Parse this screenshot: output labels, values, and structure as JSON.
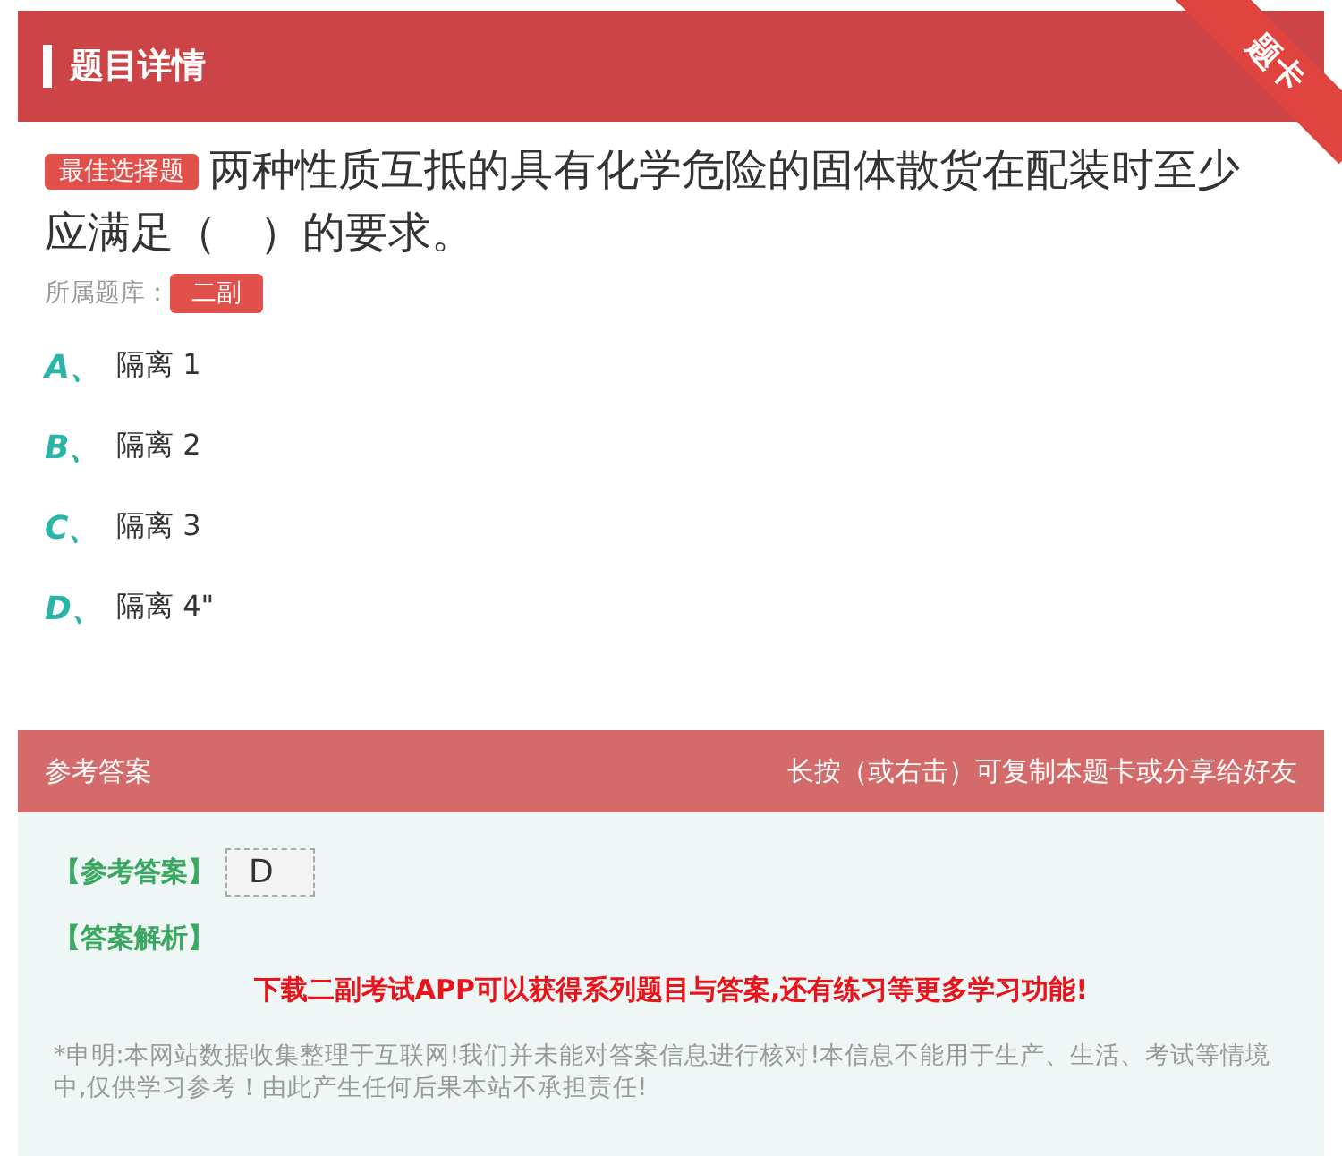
{
  "header": {
    "title": "题目详情",
    "ribbon": "题卡"
  },
  "question": {
    "type_badge": "最佳选择题",
    "text": "两种性质互抵的具有化学危险的固体散货在配装时至少应满足（　）的要求。",
    "bank_label": "所属题库：",
    "bank": "二副"
  },
  "options": [
    {
      "letter": "A、",
      "text": "隔离 1"
    },
    {
      "letter": "B、",
      "text": "隔离 2"
    },
    {
      "letter": "C、",
      "text": "隔离 3"
    },
    {
      "letter": "D、",
      "text": "隔离 4\""
    }
  ],
  "answer_section": {
    "title": "参考答案",
    "hint": "长按（或右击）可复制本题卡或分享给好友",
    "answer_label": "【参考答案】",
    "answer": "D",
    "analysis_label": "【答案解析】",
    "promo": "下载二副考试APP可以获得系列题目与答案,还有练习等更多学习功能!",
    "disclaimer": "*申明:本网站数据收集整理于互联网!我们并未能对答案信息进行核对!本信息不能用于生产、生活、考试等情境中,仅供学习参考！由此产生任何后果本站不承担责任!"
  }
}
